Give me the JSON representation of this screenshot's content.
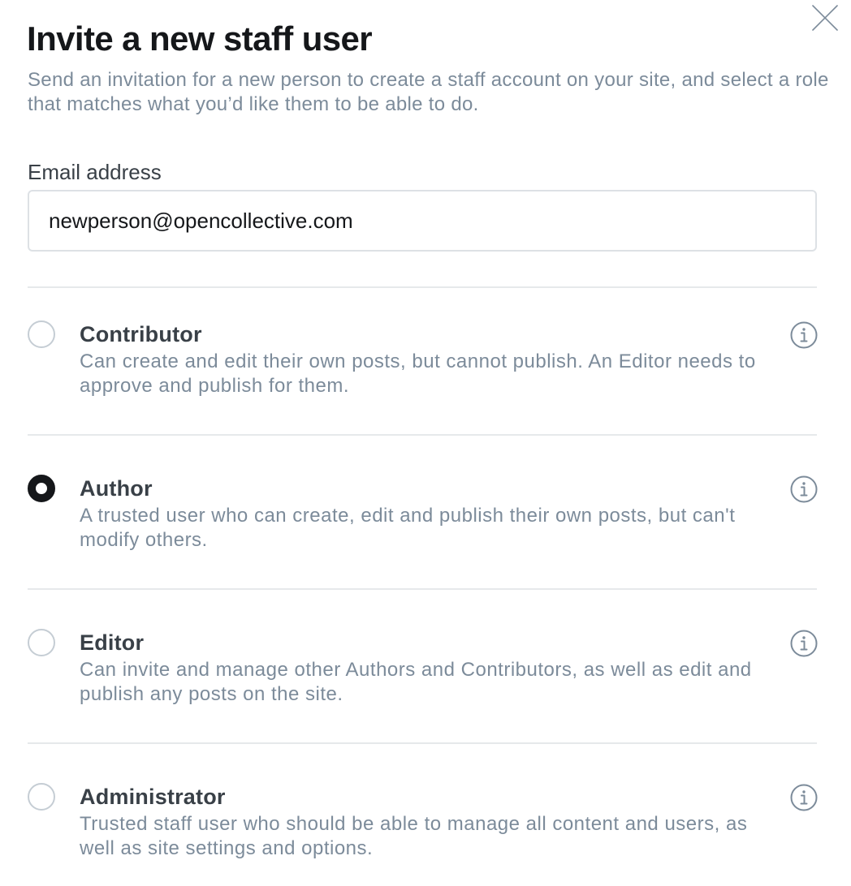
{
  "modal": {
    "title": "Invite a new staff user",
    "description": "Send an invitation for a new person to create a staff account on your site, and select a role that matches what you’d like them to be able to do.",
    "close_icon": "close-icon"
  },
  "email": {
    "label": "Email address",
    "value": "newperson@opencollective.com"
  },
  "roles": [
    {
      "name": "Contributor",
      "description": "Can create and edit their own posts, but cannot publish. An Editor needs to approve and publish for them.",
      "selected": false,
      "icon": "info-icon"
    },
    {
      "name": "Author",
      "description": "A trusted user who can create, edit and publish their own posts, but can't modify others.",
      "selected": true,
      "icon": "info-icon"
    },
    {
      "name": "Editor",
      "description": "Can invite and manage other Authors and Contributors, as well as edit and publish any posts on the site.",
      "selected": false,
      "icon": "info-icon"
    },
    {
      "name": "Administrator",
      "description": "Trusted staff user who should be able to manage all content and users, as well as site settings and options.",
      "selected": false,
      "icon": "info-icon"
    }
  ],
  "colors": {
    "title": "#15171a",
    "muted_text": "#7c8b9a",
    "role_name": "#394047",
    "border": "#dde1e5",
    "divider": "#e6e9eb",
    "radio_selected": "#15171a"
  }
}
